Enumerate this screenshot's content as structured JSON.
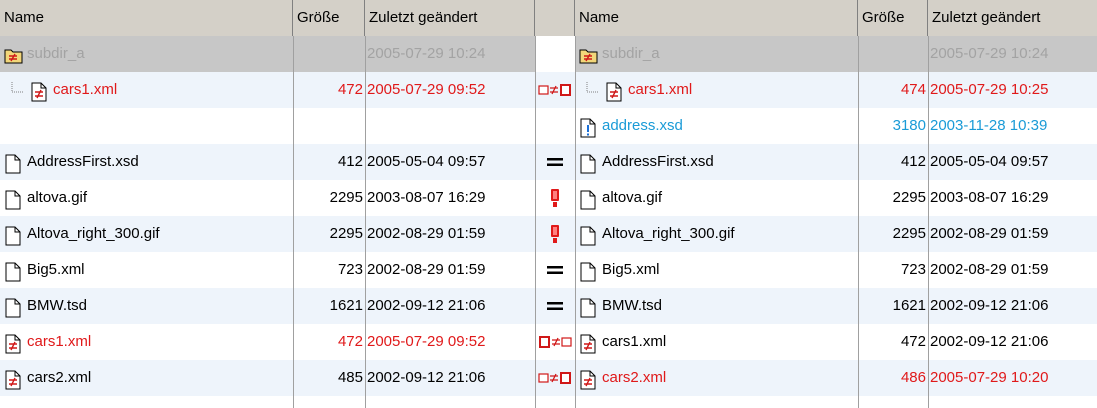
{
  "headers": {
    "name": "Name",
    "size": "Größe",
    "modified": "Zuletzt geändert"
  },
  "rows": [
    {
      "row_type": "dir",
      "left": {
        "name": "subdir_a",
        "size": "",
        "date": "2005-07-29 10:24",
        "icon": "folder-diff-icon",
        "color": "gray"
      },
      "right": {
        "name": "subdir_a",
        "size": "",
        "date": "2005-07-29 10:24",
        "icon": "folder-diff-icon",
        "color": "gray"
      },
      "compare": "none"
    },
    {
      "row_type": "child",
      "left": {
        "name": "cars1.xml",
        "size": "472",
        "date": "2005-07-29 09:52",
        "icon": "file-diff-icon",
        "color": "red"
      },
      "right": {
        "name": "cars1.xml",
        "size": "474",
        "date": "2005-07-29 10:25",
        "icon": "file-diff-icon",
        "color": "red"
      },
      "compare": "newer-right-icon"
    },
    {
      "row_type": "empty-left",
      "left": {
        "name": "",
        "size": "",
        "date": "",
        "icon": "",
        "color": ""
      },
      "right": {
        "name": "address.xsd",
        "size": "3180",
        "date": "2003-11-28 10:39",
        "icon": "file-only-icon",
        "color": "blue"
      },
      "compare": "none"
    },
    {
      "row_type": "file",
      "left": {
        "name": "AddressFirst.xsd",
        "size": "412",
        "date": "2005-05-04 09:57",
        "icon": "file-icon",
        "color": "black"
      },
      "right": {
        "name": "AddressFirst.xsd",
        "size": "412",
        "date": "2005-05-04 09:57",
        "icon": "file-icon",
        "color": "black"
      },
      "compare": "equal-icon"
    },
    {
      "row_type": "file",
      "left": {
        "name": "altova.gif",
        "size": "2295",
        "date": "2003-08-07 16:29",
        "icon": "file-icon",
        "color": "black"
      },
      "right": {
        "name": "altova.gif",
        "size": "2295",
        "date": "2003-08-07 16:29",
        "icon": "file-icon",
        "color": "black"
      },
      "compare": "binary-equal-icon"
    },
    {
      "row_type": "file",
      "left": {
        "name": "Altova_right_300.gif",
        "size": "2295",
        "date": "2002-08-29 01:59",
        "icon": "file-icon",
        "color": "black"
      },
      "right": {
        "name": "Altova_right_300.gif",
        "size": "2295",
        "date": "2002-08-29 01:59",
        "icon": "file-icon",
        "color": "black"
      },
      "compare": "binary-equal-icon"
    },
    {
      "row_type": "file",
      "left": {
        "name": "Big5.xml",
        "size": "723",
        "date": "2002-08-29 01:59",
        "icon": "file-icon",
        "color": "black"
      },
      "right": {
        "name": "Big5.xml",
        "size": "723",
        "date": "2002-08-29 01:59",
        "icon": "file-icon",
        "color": "black"
      },
      "compare": "equal-icon"
    },
    {
      "row_type": "file",
      "left": {
        "name": "BMW.tsd",
        "size": "1621",
        "date": "2002-09-12 21:06",
        "icon": "file-icon",
        "color": "black"
      },
      "right": {
        "name": "BMW.tsd",
        "size": "1621",
        "date": "2002-09-12 21:06",
        "icon": "file-icon",
        "color": "black"
      },
      "compare": "equal-icon"
    },
    {
      "row_type": "file",
      "left": {
        "name": "cars1.xml",
        "size": "472",
        "date": "2005-07-29 09:52",
        "icon": "file-diff-icon",
        "color": "red"
      },
      "right": {
        "name": "cars1.xml",
        "size": "472",
        "date": "2002-09-12 21:06",
        "icon": "file-diff-icon",
        "color": "black"
      },
      "compare": "newer-left-icon"
    },
    {
      "row_type": "file",
      "left": {
        "name": "cars2.xml",
        "size": "485",
        "date": "2002-09-12 21:06",
        "icon": "file-diff-icon",
        "color": "black"
      },
      "right": {
        "name": "cars2.xml",
        "size": "486",
        "date": "2005-07-29 10:20",
        "icon": "file-diff-icon",
        "color": "red"
      },
      "compare": "newer-right-icon"
    }
  ],
  "colors": {
    "header_bg": "#d4d0c8",
    "dir_row_bg": "#c7c7c7",
    "alt_row_bg": "#eef4fb",
    "diff_red": "#e0191a",
    "only_blue": "#1a9bd7",
    "dir_date_gray": "#a3a3a3"
  }
}
